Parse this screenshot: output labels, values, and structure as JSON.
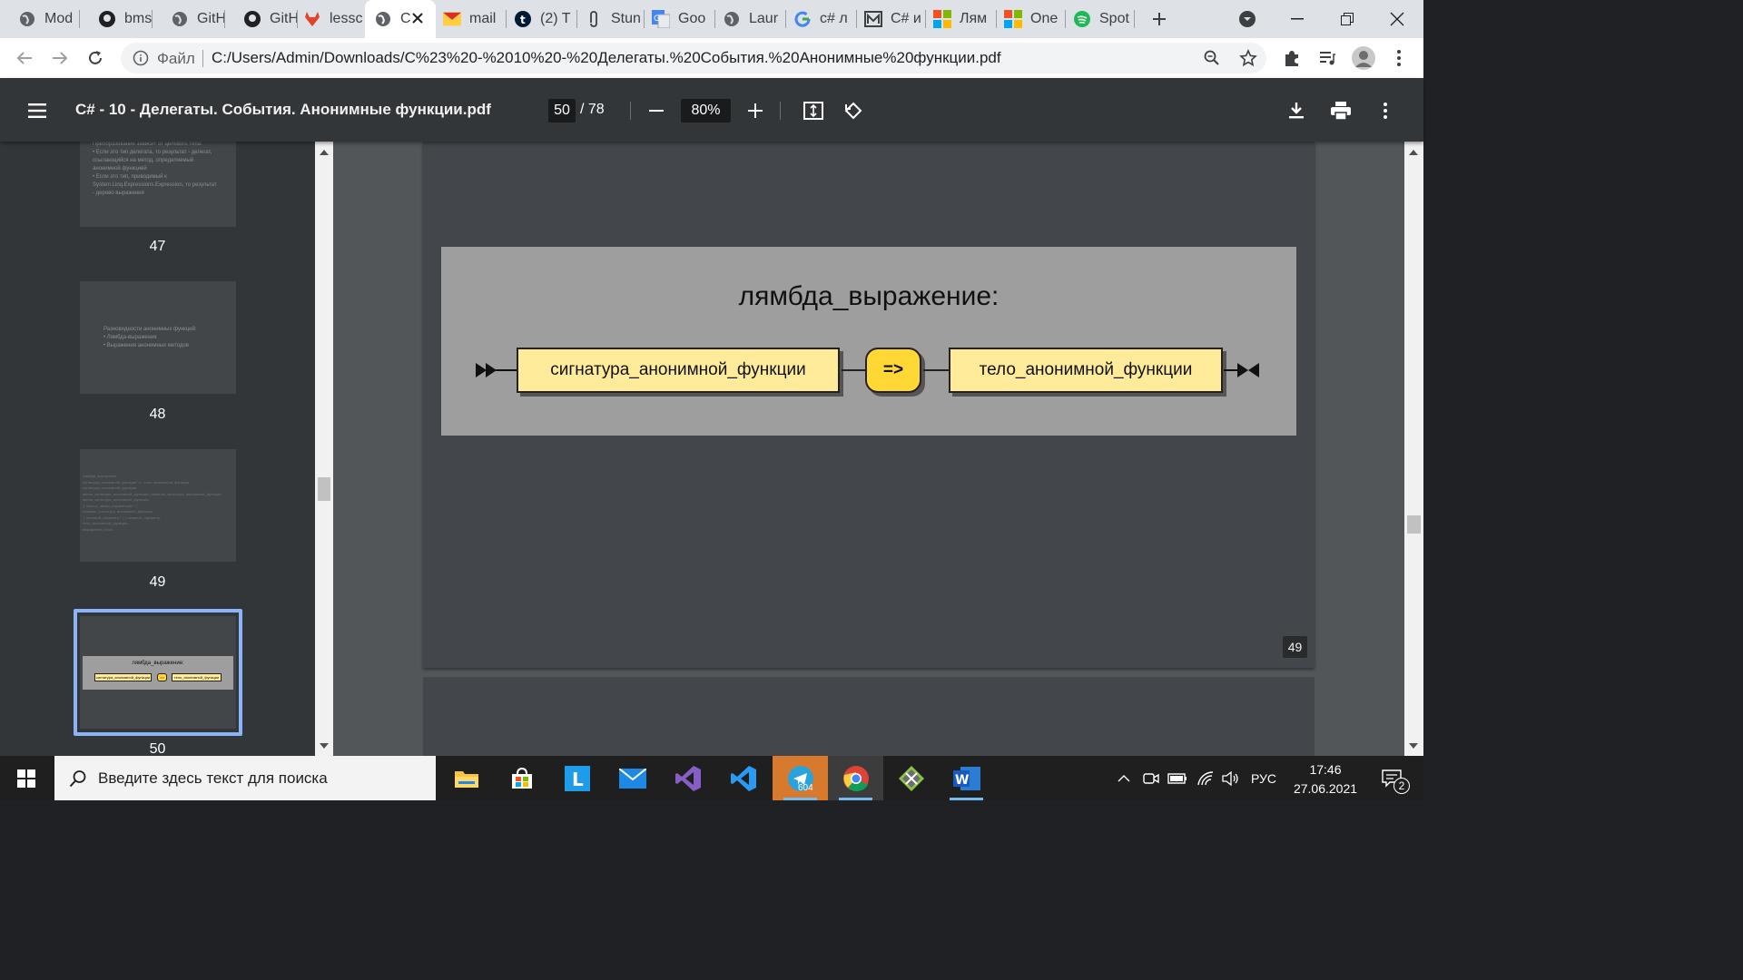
{
  "tabs": [
    {
      "label": "Mod",
      "icon": "globe-icon"
    },
    {
      "label": "bms",
      "icon": "github-icon"
    },
    {
      "label": "GitH",
      "icon": "globe-icon"
    },
    {
      "label": "GitH",
      "icon": "github-icon"
    },
    {
      "label": "lessc",
      "icon": "gitlab-icon"
    },
    {
      "label": "C",
      "icon": "globe-icon",
      "active": true
    },
    {
      "label": "mail",
      "icon": "gmail-icon"
    },
    {
      "label": "(2) T",
      "icon": "tumblr-icon"
    },
    {
      "label": "Stun",
      "icon": "paperclip-icon"
    },
    {
      "label": "Goo",
      "icon": "google-translate-icon"
    },
    {
      "label": "Laur",
      "icon": "globe-icon"
    },
    {
      "label": "c# л",
      "icon": "google-icon"
    },
    {
      "label": "C# и",
      "icon": "m-icon"
    },
    {
      "label": "Лям",
      "icon": "microsoft-icon"
    },
    {
      "label": "One",
      "icon": "microsoft-icon"
    },
    {
      "label": "Spot",
      "icon": "spotify-icon"
    }
  ],
  "omnibox": {
    "prefix": "Файл",
    "url": "C:/Users/Admin/Downloads/C%23%20-%2010%20-%20Делегаты.%20События.%20Анонимные%20функции.pdf"
  },
  "pdf": {
    "title": "C# - 10 - Делегаты. События. Анонимные функции.pdf",
    "current_page": "50",
    "total_pages": "/ 78",
    "zoom": "80%"
  },
  "thumbnails": [
    {
      "number": "47",
      "lines": [
        "Преобразование зависит от целевого типа:",
        "• Если это тип делегата, то результат - делегат,",
        "  ссылающийся на метод, определяемый",
        "  анонимной функцией",
        "• Если это тип, приводимый к",
        "  System.Linq.Expressions.Expression, то результат",
        "  - дерево выражения"
      ]
    },
    {
      "number": "48",
      "lines": [
        "Разновидности анонимных функций:",
        "• Лямбда-выражения",
        "• Выражения анонимных методов"
      ]
    },
    {
      "number": "49",
      "lines": [
        "лямбда_выражение:",
        "    сигнатура_анонимной_функции '=>' тело_анонимной_функции",
        "сигнатура_анонимной_функции:",
        "    явная_сигнатура_анонимной_функции | неявная_сигнатура_анонимной_функции",
        "явная_сигнатура_анонимной_функции:",
        "    '(' список_явных_параметров? ')'",
        "неявная_сигнатура_анонимной_функции:",
        "    '(' неявный_параметр? ')' | неявный_параметр",
        "тело_анонимной_функции:",
        "    выражение | блок"
      ]
    },
    {
      "number": "50",
      "selected": true,
      "title": "лямбда_выражение:",
      "box1": "сигнатура_анонимной_функции",
      "arrow": "=>",
      "box2": "тело_анонимной_функции"
    }
  ],
  "slide": {
    "title": "лямбда_выражение:",
    "box1": "сигнатура_анонимной_функции",
    "arrow": "=>",
    "box2": "тело_анонимной_функции",
    "page_badge": "49"
  },
  "taskbar": {
    "search_placeholder": "Введите здесь текст для поиска",
    "telegram_badge": "604",
    "language": "РУС",
    "time": "17:46",
    "date": "27.06.2021",
    "notifications": "2"
  }
}
